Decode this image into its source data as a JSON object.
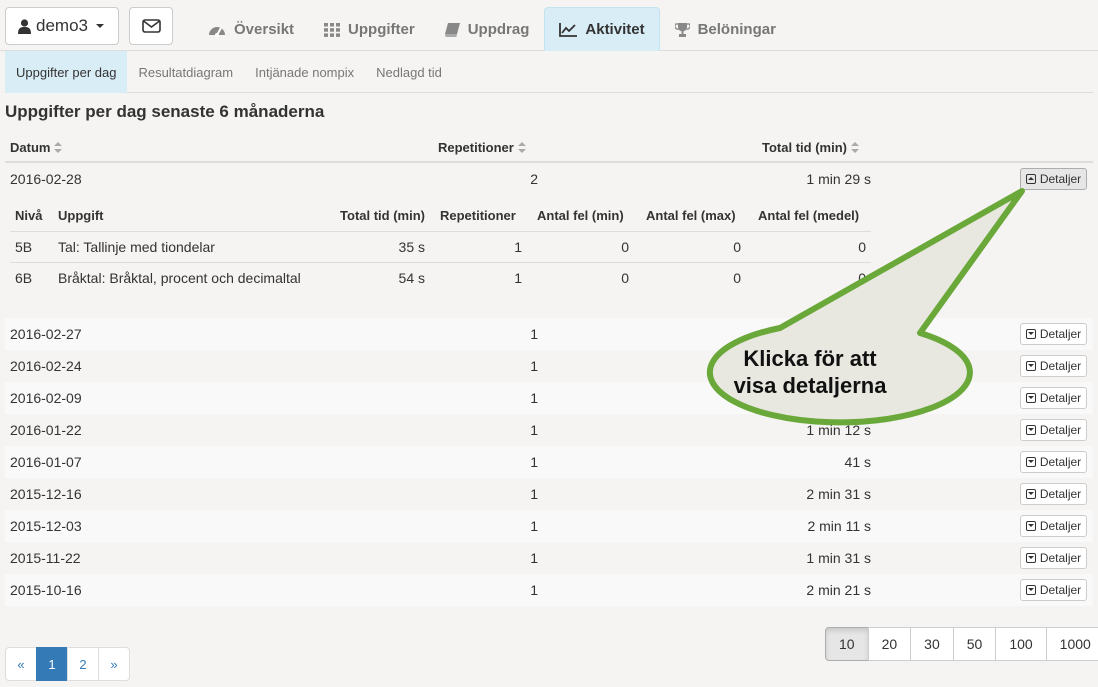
{
  "user": {
    "name": "demo3"
  },
  "tabs": [
    {
      "label": "Översikt",
      "icon": "dashboard-icon"
    },
    {
      "label": "Uppgifter",
      "icon": "grid-icon"
    },
    {
      "label": "Uppdrag",
      "icon": "book-icon"
    },
    {
      "label": "Aktivitet",
      "icon": "line-chart-icon",
      "active": true
    },
    {
      "label": "Belöningar",
      "icon": "trophy-icon"
    }
  ],
  "subtabs": [
    {
      "label": "Uppgifter per dag",
      "active": true
    },
    {
      "label": "Resultatdiagram"
    },
    {
      "label": "Intjänade nompix"
    },
    {
      "label": "Nedlagd tid"
    }
  ],
  "heading": "Uppgifter per dag senaste 6 månaderna",
  "table": {
    "headers": {
      "date": "Datum",
      "repetitions": "Repetitioner",
      "total_time": "Total tid (min)"
    },
    "details_label": "Detaljer",
    "rows": [
      {
        "date": "2016-02-28",
        "repetitions": "2",
        "total_time": "1 min 29 s",
        "expanded": true
      },
      {
        "date": "2016-02-27",
        "repetitions": "1",
        "total_time": ""
      },
      {
        "date": "2016-02-24",
        "repetitions": "1",
        "total_time": ""
      },
      {
        "date": "2016-02-09",
        "repetitions": "1",
        "total_time": ""
      },
      {
        "date": "2016-01-22",
        "repetitions": "1",
        "total_time": "1 min 12 s"
      },
      {
        "date": "2016-01-07",
        "repetitions": "1",
        "total_time": "41 s"
      },
      {
        "date": "2015-12-16",
        "repetitions": "1",
        "total_time": "2 min 31 s"
      },
      {
        "date": "2015-12-03",
        "repetitions": "1",
        "total_time": "2 min 11 s"
      },
      {
        "date": "2015-11-22",
        "repetitions": "1",
        "total_time": "1 min 31 s"
      },
      {
        "date": "2015-10-16",
        "repetitions": "1",
        "total_time": "2 min 21 s"
      }
    ]
  },
  "details": {
    "headers": {
      "level": "Nivå",
      "task": "Uppgift",
      "total_time": "Total tid (min)",
      "repetitions": "Repetitioner",
      "errors_min": "Antal fel (min)",
      "errors_max": "Antal fel (max)",
      "errors_avg": "Antal fel (medel)"
    },
    "rows": [
      {
        "level": "5B",
        "task": "Tal: Tallinje med tiondelar",
        "total_time": "35 s",
        "repetitions": "1",
        "errors_min": "0",
        "errors_max": "0",
        "errors_avg": "0"
      },
      {
        "level": "6B",
        "task": "Bråktal: Bråktal, procent och decimaltal",
        "total_time": "54 s",
        "repetitions": "1",
        "errors_min": "0",
        "errors_max": "0",
        "errors_avg": "0"
      }
    ]
  },
  "callout": {
    "line1": "Klicka för att",
    "line2": "visa detaljerna",
    "fill_color": "#e8e8e0",
    "border_color": "#6aa83a"
  },
  "pagination": {
    "prev": "«",
    "pages": [
      "1",
      "2"
    ],
    "current": "1",
    "next": "»"
  },
  "page_sizes": {
    "options": [
      "10",
      "20",
      "30",
      "50",
      "100",
      "1000"
    ],
    "selected": "10"
  }
}
